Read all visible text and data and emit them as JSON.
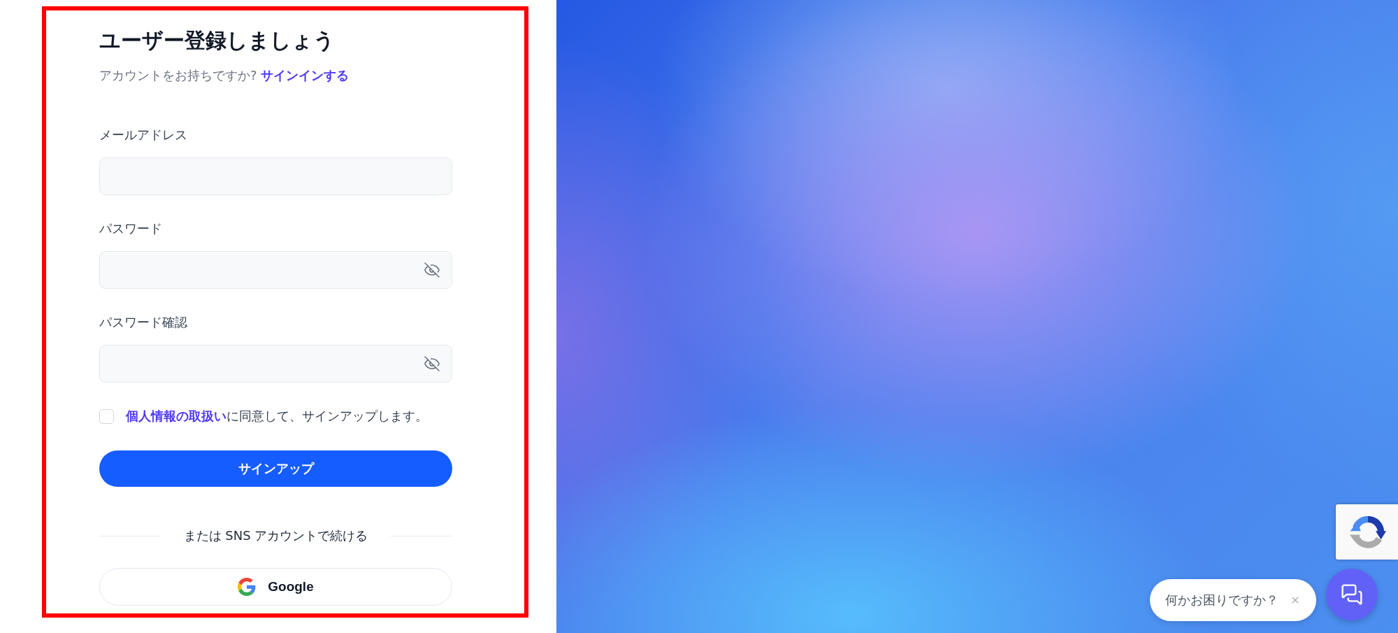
{
  "form": {
    "title": "ユーザー登録しましょう",
    "signin_prompt": {
      "text": "アカウントをお持ちですか?",
      "link": "サインインする"
    },
    "fields": [
      {
        "label": "メールアドレス",
        "kind": "email"
      },
      {
        "label": "パスワード",
        "kind": "password"
      },
      {
        "label": "パスワード確認",
        "kind": "password"
      }
    ],
    "consent": {
      "checked": false,
      "link": "個人情報の取扱い",
      "text": "に同意して、サインアップします。"
    },
    "submit_button": "サインアップ",
    "divider": "または SNS アカウントで続ける",
    "social_buttons": [
      {
        "kind": "google",
        "label": "Google"
      }
    ]
  },
  "chat": {
    "prompt": "何かお困りですか？"
  }
}
